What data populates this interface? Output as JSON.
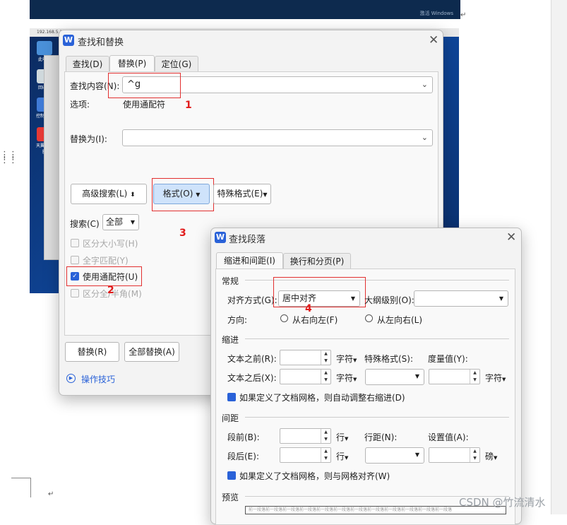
{
  "background": {
    "top_screenshot_text": "激活 Windows",
    "remote_title": "192.168.5.1",
    "remote_icons": [
      {
        "label": "此电脑",
        "color": "#4a90d9"
      },
      {
        "label": "回收站",
        "color": "#cfd8dc"
      },
      {
        "label": "控制面板",
        "color": "#3f7ad6"
      },
      {
        "label": "天翼云电脑",
        "color": "#e53935"
      }
    ],
    "paragraph_mark": "↵"
  },
  "find_replace": {
    "title": "查找和替换",
    "tabs": [
      "查找(D)",
      "替换(P)",
      "定位(G)"
    ],
    "active_tab": 1,
    "find_label": "查找内容(N):",
    "find_value": "^g",
    "options_label": "选项:",
    "options_value": "使用通配符",
    "replace_label": "替换为(I):",
    "replace_value": "",
    "advanced_button": "高级搜索(L)",
    "format_button": "格式(O)",
    "special_button": "特殊格式(E)",
    "search_label": "搜索(C)",
    "search_value": "全部",
    "checkboxes": [
      {
        "label": "区分大小写(H)",
        "checked": false,
        "enabled": false
      },
      {
        "label": "全字匹配(Y)",
        "checked": false,
        "enabled": false
      },
      {
        "label": "使用通配符(U)",
        "checked": true,
        "enabled": true
      },
      {
        "label": "区分全/半角(M)",
        "checked": false,
        "enabled": false
      }
    ],
    "replace_button": "替换(R)",
    "replace_all_button": "全部替换(A)",
    "tips_link": "操作技巧"
  },
  "find_paragraph": {
    "title": "查找段落",
    "tabs": [
      "缩进和间距(I)",
      "换行和分页(P)"
    ],
    "active_tab": 0,
    "general_heading": "常规",
    "align_label": "对齐方式(G):",
    "align_value": "居中对齐",
    "outline_label": "大纲级别(O):",
    "outline_value": "",
    "direction_label": "方向:",
    "rtl_label": "从右向左(F)",
    "ltr_label": "从左向右(L)",
    "indent_heading": "缩进",
    "before_text_label": "文本之前(R):",
    "after_text_label": "文本之后(X):",
    "char_unit": "字符",
    "special_format_label": "特殊格式(S):",
    "measure_label": "度量值(Y):",
    "auto_indent_label": "如果定义了文档网格，则自动调整右缩进(D)",
    "spacing_heading": "间距",
    "before_para_label": "段前(B):",
    "after_para_label": "段后(E):",
    "line_unit": "行",
    "line_spacing_label": "行距(N):",
    "set_value_label": "设置值(A):",
    "pound_unit": "磅",
    "grid_align_label": "如果定义了文档网格，则与网格对齐(W)",
    "preview_heading": "预览",
    "preview_text": "前一段落前一段落前一段落前一段落前一段落前一段落前一段落前一段落前一段落前一段落前一段落前一段落"
  },
  "annotations": [
    "1",
    "2",
    "3",
    "4"
  ],
  "watermark": "CSDN @竹流清水",
  "colors": {
    "accent": "#2a62d8",
    "annotation_red": "#e11b1b"
  }
}
